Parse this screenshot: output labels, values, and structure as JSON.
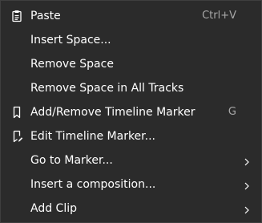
{
  "menu": {
    "items": [
      {
        "label": "Paste",
        "shortcut": "Ctrl+V",
        "icon": "clipboard-icon"
      },
      {
        "label": "Insert Space..."
      },
      {
        "label": "Remove Space"
      },
      {
        "label": "Remove Space in All Tracks"
      },
      {
        "label": "Add/Remove Timeline Marker",
        "shortcut": "G",
        "icon": "bookmark-icon"
      },
      {
        "label": "Edit Timeline Marker...",
        "icon": "bookmark-edit-icon"
      },
      {
        "label": "Go to Marker...",
        "submenu": true
      },
      {
        "label": "Insert a composition...",
        "submenu": true
      },
      {
        "label": "Add Clip",
        "submenu": true
      }
    ]
  },
  "colors": {
    "background": "#2b2b2b",
    "border": "#3f3f3f",
    "text": "#ffffff",
    "shortcut": "#a8a8a8"
  }
}
